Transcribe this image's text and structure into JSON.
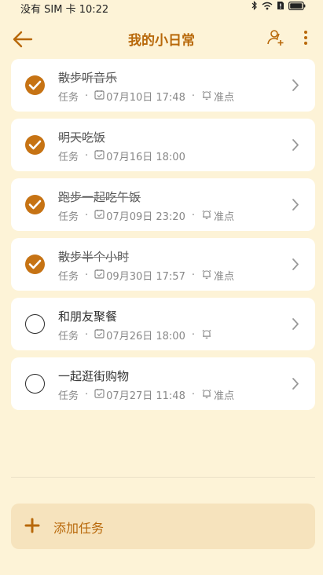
{
  "status_bar": {
    "carrier": "没有 SIM 卡",
    "time": "10:22"
  },
  "header": {
    "title": "我的小日常"
  },
  "tasks": [
    {
      "title": "散步听音乐",
      "type": "任务",
      "datetime": "07月10日 17:48",
      "reminder": "准点",
      "done": true
    },
    {
      "title": "明天吃饭",
      "type": "任务",
      "datetime": "07月16日 18:00",
      "reminder": "",
      "done": true
    },
    {
      "title": "跑步一起吃午饭",
      "type": "任务",
      "datetime": "07月09日 23:20",
      "reminder": "准点",
      "done": true
    },
    {
      "title": "散步半个小时",
      "type": "任务",
      "datetime": "09月30日 17:57",
      "reminder": "准点",
      "done": true
    },
    {
      "title": "和朋友聚餐",
      "type": "任务",
      "datetime": "07月26日 18:00",
      "reminder": "",
      "done": false,
      "reminder_icon_only": true
    },
    {
      "title": "一起逛街购物",
      "type": "任务",
      "datetime": "07月27日 11:48",
      "reminder": "准点",
      "done": false
    }
  ],
  "footer": {
    "add_label": "添加任务"
  },
  "colors": {
    "accent": "#c67314",
    "background": "#fdf3d7",
    "add_bar": "#f6e3bd"
  }
}
